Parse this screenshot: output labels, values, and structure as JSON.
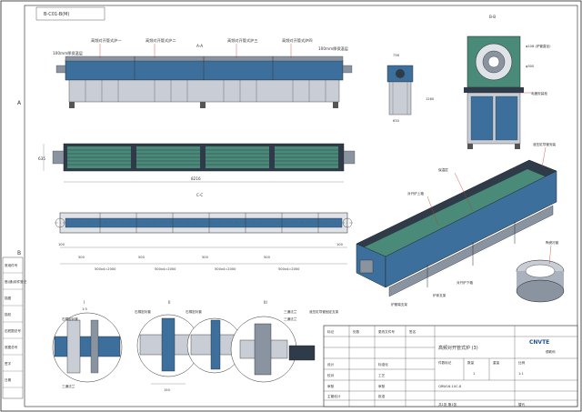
{
  "title_block": {
    "company_logo_text": "CNVTE",
    "company_name": "德乾科",
    "part_name": "高频对开管式炉 (3)",
    "drawing_no": "QRW16-10C-8",
    "scale": "1:1",
    "quantity": "1",
    "material": "",
    "header_labels": [
      "件数标记",
      "数量",
      "重量",
      "比例"
    ],
    "row_labels": [
      "设计",
      "校对",
      "审核",
      "主管设计",
      "标准化",
      "工艺",
      "审核",
      "批准"
    ],
    "change_header": [
      "标记",
      "处数",
      "分区",
      "更改文件号",
      "签名",
      "日期"
    ],
    "sheet_info": "共1张 第1张",
    "revision_label": "替代"
  },
  "top_label": "B-C01-B(M)",
  "left_strip": [
    "借(通)用件登记",
    "旧底图总号",
    "底图总号",
    "签字",
    "日期",
    "描图",
    "描校",
    "常用件号"
  ],
  "section_labels": {
    "a_a": "A-A",
    "b_b": "B-B",
    "c_c": "C-C",
    "i_detail": "I",
    "ii_detail": "II",
    "iii_detail": "III",
    "scale_1_5": "1:5"
  },
  "view1_callouts": [
    "高频对开管式炉一",
    "高频对开管式炉二",
    "高频对开管式炉三",
    "高频对开管式炉四",
    "100mm厚保温层",
    "100mm厚保温层"
  ],
  "view2_dims": {
    "overall": "8216",
    "height": "635"
  },
  "view3_dims": [
    "100",
    "500",
    "500x4=2000",
    "500",
    "500x4=2000",
    "500",
    "500x4=2000",
    "500",
    "500x4=2000",
    "100"
  ],
  "side_view": {
    "width": "736",
    "base": "630",
    "height": "1260"
  },
  "section_b_callouts": [
    "φ108 (炉管直径)",
    "φ300",
    "电器安装柜"
  ],
  "iso_callouts": [
    "保温层",
    "对开炉上箱",
    "对开炉下箱",
    "炉管端支架",
    "炉体支架",
    "液压缸导管安装",
    "炉管 (整体)"
  ],
  "ring_callout": "陶瓷衬套",
  "detail_callouts": [
    "石棉密封套",
    "石棉密封套",
    "石棉密封套",
    "三通法兰",
    "三通法兰",
    "液压缸导管固定支架",
    "三通法兰"
  ],
  "detail_dims": [
    "150"
  ],
  "left_border_letters": [
    "A",
    "B",
    "C",
    "D"
  ],
  "top_numbers": [
    "1",
    "2",
    "3",
    "4",
    "5",
    "6",
    "7",
    "8"
  ],
  "colors": {
    "furnace_blue": "#3c6f9c",
    "furnace_dark": "#2f3b48",
    "tube_green": "#4a8a78",
    "frame_grey": "#8a93a0",
    "leader_red": "#c23a2e"
  }
}
